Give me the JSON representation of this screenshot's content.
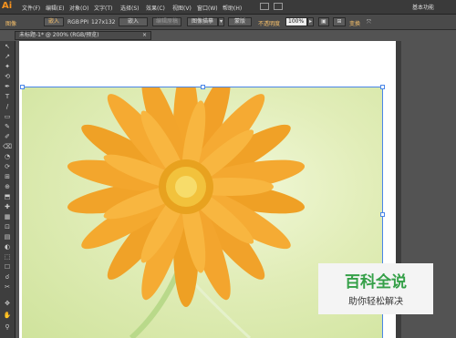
{
  "menubar": {
    "logo": "Ai",
    "items": [
      "文件(F)",
      "编辑(E)",
      "对象(O)",
      "文字(T)",
      "选择(S)",
      "效果(C)",
      "视图(V)",
      "窗口(W)",
      "帮助(H)"
    ],
    "workspace": "基本功能"
  },
  "control": {
    "selection_label": "图像",
    "embed_label": "嵌入",
    "color_mode": "RGB",
    "ppi_label": "PPI",
    "ppi_value": "127x132",
    "embed_btn": "嵌入",
    "edit_original_btn": "编辑原稿",
    "image_trace_btn": "图像描摹",
    "mask_btn": "蒙版",
    "opacity_label": "不透明度",
    "opacity_value": "100%",
    "transform_label": "变换"
  },
  "tab": {
    "title": "未标题-1* @ 200% (RGB/预览)",
    "close": "×"
  },
  "tools": [
    "↖",
    "↗",
    "✦",
    "⟲",
    "✒",
    "T",
    "/",
    "▭",
    "✎",
    "✐",
    "⌫",
    "◔",
    "⟳",
    "⊞",
    "⊕",
    "⬒",
    "✚",
    "▦",
    "⊡",
    "▤",
    "◐",
    "⬚",
    "☐",
    "☌",
    "✂",
    "✥",
    "✋",
    "⚲"
  ],
  "watermark": {
    "title": "百科全说",
    "subtitle": "助你轻松解决"
  },
  "colors": {
    "app_bg": "#535353",
    "accent_logo": "#f7931e",
    "selection": "#4a86e8",
    "watermark_green": "#35a048"
  }
}
